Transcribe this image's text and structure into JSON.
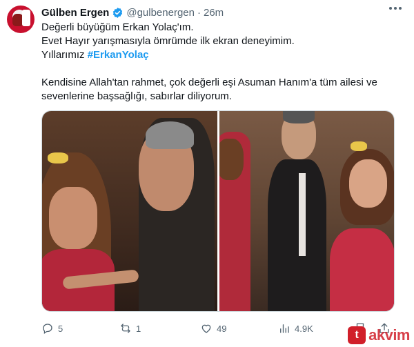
{
  "author": {
    "name": "Gülben Ergen",
    "handle": "@gulbenergen",
    "separator": "·",
    "time": "26m"
  },
  "tweet": {
    "lines": [
      "Değerli büyüğüm Erkan Yolaç'ım.",
      "Evet Hayır yarışmasıyla ömrümde ilk ekran deneyimim.",
      "Yıllarımız "
    ],
    "hashtag": "#ErkanYolaç",
    "lines2": [
      "Kendisine Allah'tan rahmet, çok değerli eşi Asuman Hanım'a tüm ailesi ve",
      "sevenlerine başsağlığı, sabırlar diliyorum."
    ]
  },
  "actions": {
    "replies": "5",
    "reposts": "1",
    "likes": "49",
    "views": "4.9K"
  },
  "colors": {
    "accent": "#1d9bf0",
    "muted": "#536471",
    "watermark": "#d11f2a"
  },
  "icons": [
    "verified-badge-icon",
    "more-icon",
    "reply-icon",
    "repost-icon",
    "like-icon",
    "views-icon",
    "bookmark-icon",
    "share-icon"
  ]
}
